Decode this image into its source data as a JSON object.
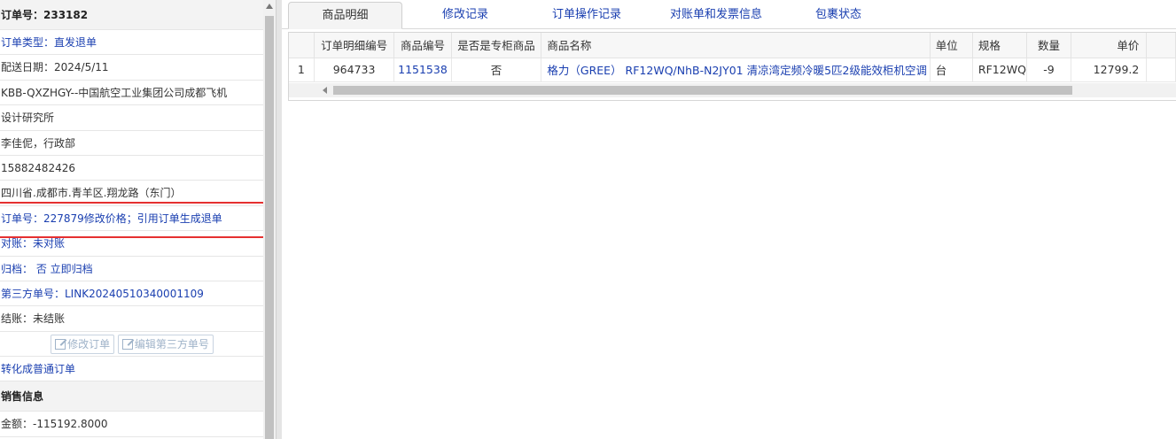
{
  "order": {
    "header": "订单号：233182",
    "type": "订单类型：直发退单",
    "delivery_date": "配送日期：2024/5/11",
    "customer_line1": "KBB-QXZHGY--中国航空工业集团公司成都飞机",
    "customer_line2": "设计研究所",
    "contact": "李佳伲，行政部",
    "phone": "15882482426",
    "address": "四川省.成都市.青羊区.翔龙路（东门）",
    "ref_order": "订单号：227879修改价格；引用订单生成退单",
    "reconcile": "对账：未对账",
    "archive": "归档： 否 立即归档",
    "third_party": "第三方单号：LINK20240510340001109",
    "settle": "结账：未结账",
    "btn_modify": "修改订单",
    "btn_edit_third": "编辑第三方单号",
    "convert": "转化成普通订单"
  },
  "sales": {
    "header": "销售信息",
    "amount": "金额：-115192.8000"
  },
  "tabs": [
    {
      "label": "商品明细",
      "active": true
    },
    {
      "label": "修改记录"
    },
    {
      "label": "订单操作记录"
    },
    {
      "label": "对账单和发票信息"
    },
    {
      "label": "包裹状态"
    }
  ],
  "grid": {
    "columns": [
      "",
      "订单明细编号",
      "商品编号",
      "是否是专柜商品",
      "商品名称",
      "单位",
      "规格",
      "数量",
      "单价"
    ],
    "rows": [
      {
        "index": "1",
        "detail_no": "964733",
        "product_no": "1151538",
        "counter": "否",
        "name": "格力（GREE） RF12WQ/NhB-N2JY01 清凉湾定频冷暖5匹2级能效柜机空调",
        "unit": "台",
        "spec": "RF12WQ",
        "qty": "-9",
        "price": "12799.2"
      }
    ]
  },
  "colors": {
    "link": "#1a3fb0",
    "highlight": "#e53030"
  }
}
